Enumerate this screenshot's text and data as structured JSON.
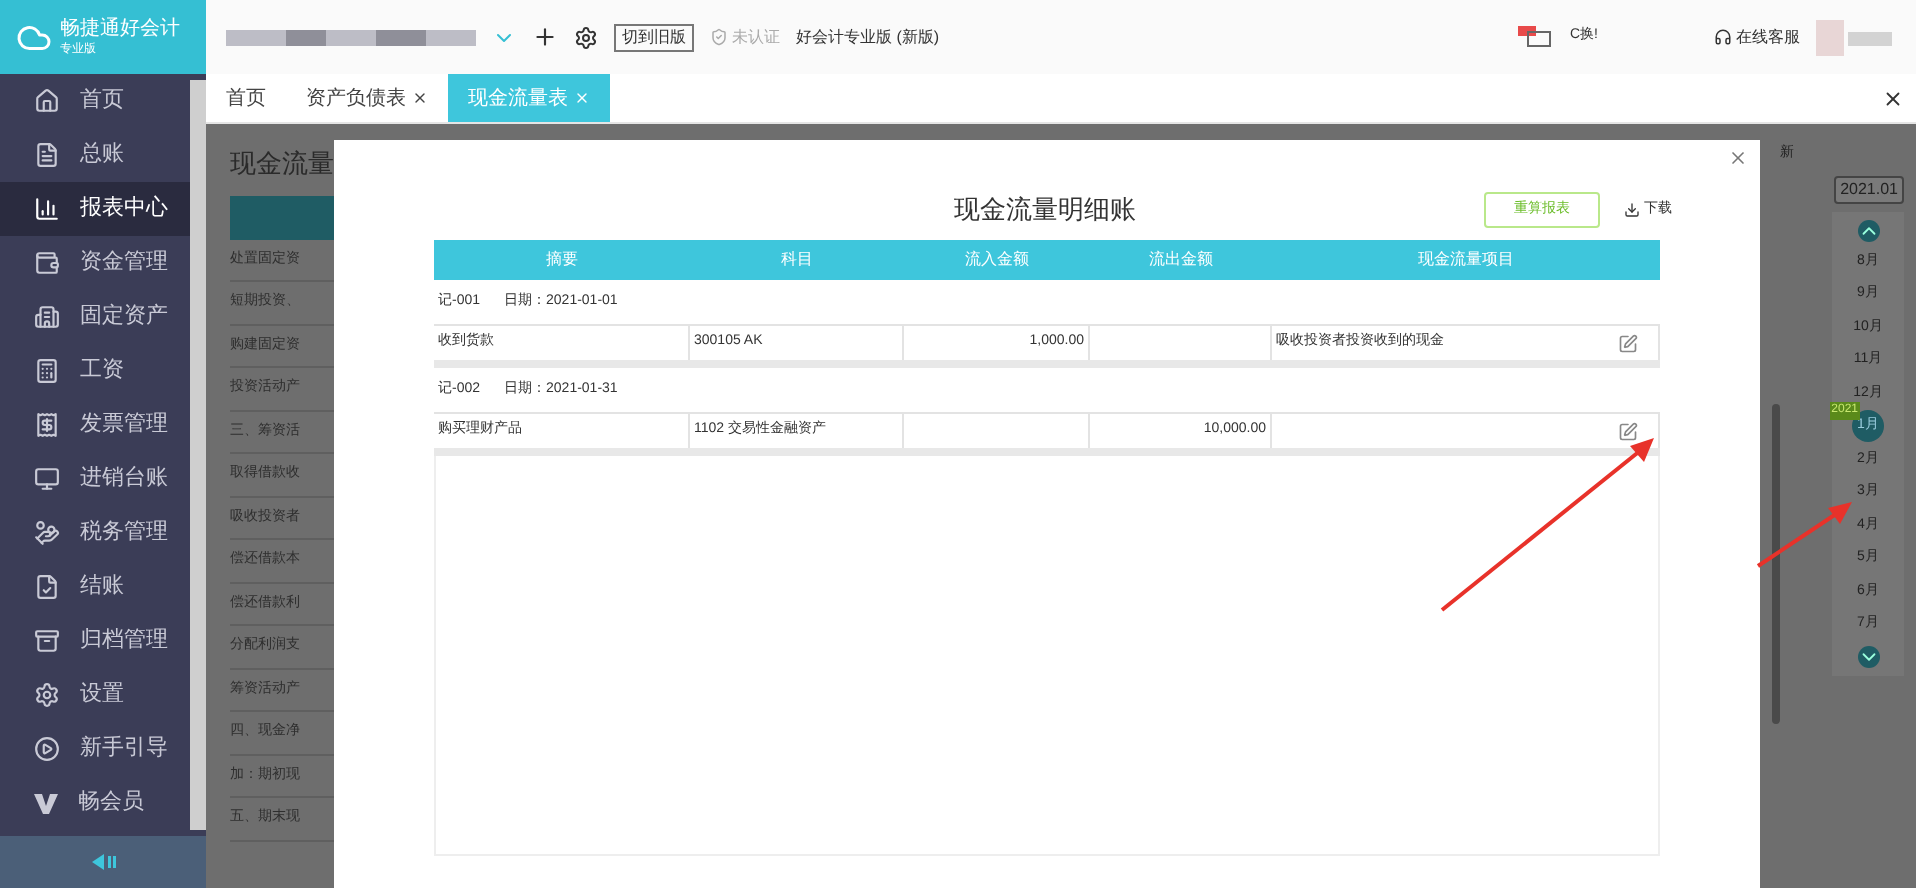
{
  "logo": {
    "name": "畅捷通好会计",
    "edition": "专业版"
  },
  "topbar": {
    "switch_button": "切到旧版",
    "cert": "未认证",
    "product": "好会计专业版 (新版)",
    "promo": "C换!",
    "service": "在线客服"
  },
  "sidebar": {
    "items": [
      {
        "label": "首页",
        "kind": "home",
        "selected": false
      },
      {
        "label": "总账",
        "kind": "ledger",
        "selected": false
      },
      {
        "label": "报表中心",
        "kind": "chart",
        "selected": true
      },
      {
        "label": "资金管理",
        "kind": "money",
        "selected": false
      },
      {
        "label": "固定资产",
        "kind": "asset",
        "selected": false
      },
      {
        "label": "工资",
        "kind": "salary",
        "selected": false
      },
      {
        "label": "发票管理",
        "kind": "invoice",
        "selected": false
      },
      {
        "label": "进销台账",
        "kind": "stock",
        "selected": false
      },
      {
        "label": "税务管理",
        "kind": "tax",
        "selected": false
      },
      {
        "label": "结账",
        "kind": "closing",
        "selected": false
      },
      {
        "label": "归档管理",
        "kind": "archive",
        "selected": false
      },
      {
        "label": "设置",
        "kind": "settings",
        "selected": false
      },
      {
        "label": "新手引导",
        "kind": "guide",
        "selected": false
      },
      {
        "label": "畅会员",
        "kind": "vip",
        "selected": false
      }
    ]
  },
  "tabs": [
    {
      "label": "首页",
      "closable": false,
      "selected": false
    },
    {
      "label": "资产负债表",
      "closable": true,
      "selected": false
    },
    {
      "label": "现金流量表",
      "closable": true,
      "selected": true
    }
  ],
  "background_page": {
    "title": "现金流量",
    "rows": [
      "处置固定资",
      "短期投资、",
      "购建固定资",
      "投资活动产",
      "三、筹资活",
      "取得借款收",
      "吸收投资者",
      "偿还借款本",
      "偿还借款利",
      "分配利润支",
      "筹资活动产",
      "四、现金净",
      "加：期初现",
      "五、期末现"
    ],
    "side_label": "新",
    "period": "2021.01",
    "months": [
      {
        "label": "8月",
        "selected": false
      },
      {
        "label": "9月",
        "selected": false
      },
      {
        "label": "10月",
        "selected": false
      },
      {
        "label": "11月",
        "selected": false
      },
      {
        "label": "12月",
        "selected": false
      },
      {
        "label": "1月",
        "selected": true,
        "badge": "2021"
      },
      {
        "label": "2月",
        "selected": false
      },
      {
        "label": "3月",
        "selected": false
      },
      {
        "label": "4月",
        "selected": false
      },
      {
        "label": "5月",
        "selected": false
      },
      {
        "label": "6月",
        "selected": false
      },
      {
        "label": "7月",
        "selected": false
      }
    ]
  },
  "dialog": {
    "title": "现金流量明细账",
    "recalc_button": "重算报表",
    "download": "下载",
    "columns": [
      "摘要",
      "科目",
      "流入金额",
      "流出金额",
      "现金流量项目"
    ],
    "groups": [
      {
        "voucher": "记-001",
        "date": "日期：2021-01-01",
        "rows": [
          [
            "收到货款",
            "300105 AK",
            "1,000.00",
            "",
            "吸收投资者投资收到的现金"
          ]
        ]
      },
      {
        "voucher": "记-002",
        "date": "日期：2021-01-31",
        "rows": [
          [
            "购买理财产品",
            "1102 交易性金融资产",
            "",
            "10,000.00",
            ""
          ]
        ]
      }
    ]
  }
}
